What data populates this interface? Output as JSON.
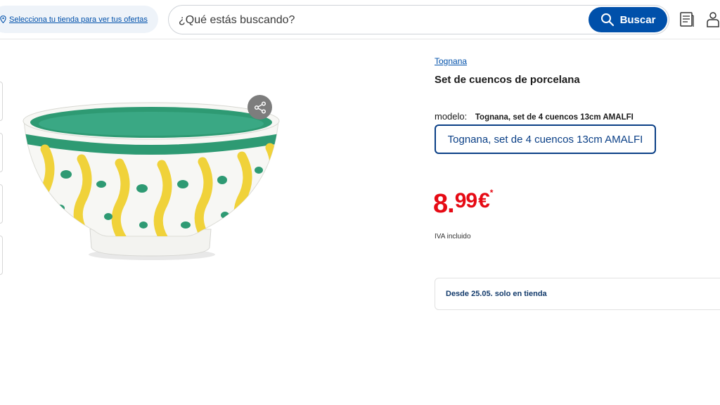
{
  "header": {
    "store_link": "Selecciona tu tienda para ver tus ofertas",
    "search_placeholder": "¿Qué estás buscando?",
    "search_button": "Buscar",
    "icons": [
      "map-pin-icon",
      "search-icon",
      "catalog-icon",
      "user-icon"
    ]
  },
  "product": {
    "brand": "Tognana",
    "title": "Set de cuencos de porcelana",
    "model_label": "modelo:",
    "model_value": "Tognana, set de 4 cuencos 13cm AMALFI",
    "variant_option": "Tognana, set de 4 cuencos 13cm AMALFI",
    "price": {
      "integer": "8",
      "separator": ".",
      "decimals": "99",
      "currency": "€",
      "asterisk": "*"
    },
    "tax_note": "IVA incluido",
    "availability": "Desde 25.05. solo en tienda"
  },
  "colors": {
    "brand_blue": "#0050aa",
    "price_red": "#e60a14",
    "variant_border": "#0a3f86",
    "bowl_green": "#2e9a73",
    "bowl_yellow": "#f0d23a"
  }
}
